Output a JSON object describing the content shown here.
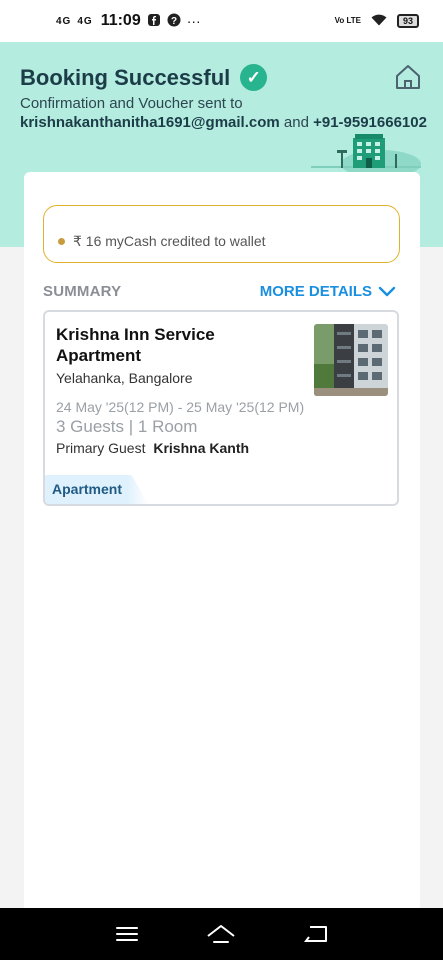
{
  "status_bar": {
    "signal1": "4G",
    "signal2": "4G",
    "time": "11:09",
    "volte": "Vo LTE",
    "battery": "93"
  },
  "header": {
    "title": "Booking Successful",
    "confirm_text": "Confirmation and Voucher sent to",
    "email": "krishnakanthanitha1691@gmail.com",
    "and_text": "and",
    "phone": "+91-9591666102"
  },
  "cash": {
    "text": "₹ 16 myCash credited to wallet"
  },
  "summary": {
    "label": "SUMMARY",
    "more_details_label": "MORE DETAILS"
  },
  "booking": {
    "hotel_name": "Krishna Inn Service Apartment",
    "location": "Yelahanka, Bangalore",
    "dates": "24 May '25(12 PM) - 25 May '25(12 PM)",
    "guests": "3 Guests | 1 Room",
    "primary_guest_label": "Primary Guest",
    "primary_guest_name": "Krishna Kanth",
    "property_type": "Apartment"
  },
  "colors": {
    "header_bg": "#b4ece0",
    "accent_green": "#27b48e",
    "link_blue": "#1a8fe0",
    "gold_border": "#e0b22c"
  }
}
